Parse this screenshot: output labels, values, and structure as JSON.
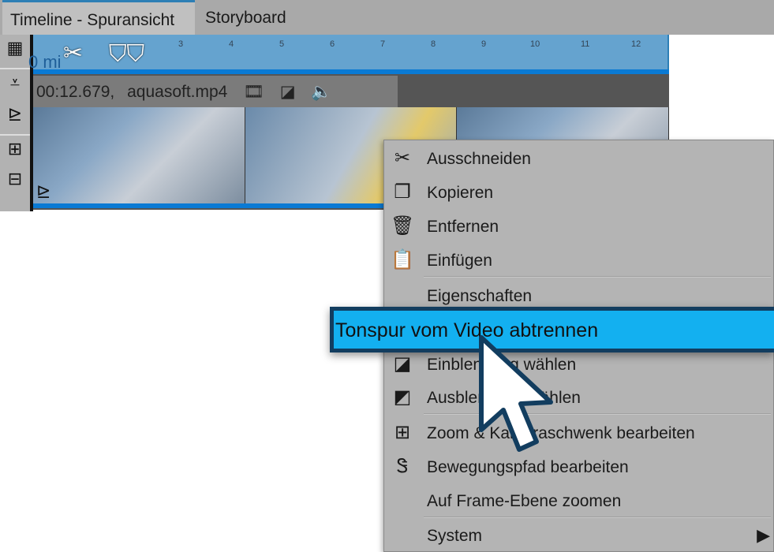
{
  "tabs": [
    {
      "label": "Timeline - Spuransicht",
      "active": true
    },
    {
      "label": "Storyboard",
      "active": false
    }
  ],
  "ruler": {
    "ticks": [
      "3",
      "4",
      "5",
      "6",
      "7",
      "8",
      "9",
      "10",
      "11",
      "12"
    ],
    "partial_label": "0 mi"
  },
  "clip": {
    "duration": "00:12.679,",
    "filename": "aquasoft.mp4"
  },
  "menu": {
    "items": [
      {
        "label": "Ausschneiden",
        "icon": "scissors-icon"
      },
      {
        "label": "Kopieren",
        "icon": "copy-icon"
      },
      {
        "label": "Entfernen",
        "icon": "trash-icon"
      },
      {
        "label": "Einfügen",
        "icon": "paste-icon"
      },
      {
        "label": "Eigenschaften",
        "icon": ""
      },
      {
        "label": "Einblendung wählen",
        "icon": "fade-in-icon"
      },
      {
        "label": "Ausblendung wählen",
        "icon": "fade-out-icon"
      },
      {
        "label": "Zoom & Kameraschwenk bearbeiten",
        "icon": "camera-pan-icon"
      },
      {
        "label": "Bewegungspfad bearbeiten",
        "icon": "motion-path-icon"
      },
      {
        "label": "Auf Frame-Ebene zoomen",
        "icon": ""
      },
      {
        "label": "System",
        "icon": "submenu-arrow-icon"
      }
    ],
    "highlighted": "Tonspur vom Video abtrennen"
  },
  "colors": {
    "highlight": "#13b0f0",
    "ruler": "#65a3cf",
    "accent": "#0a7ad4"
  }
}
